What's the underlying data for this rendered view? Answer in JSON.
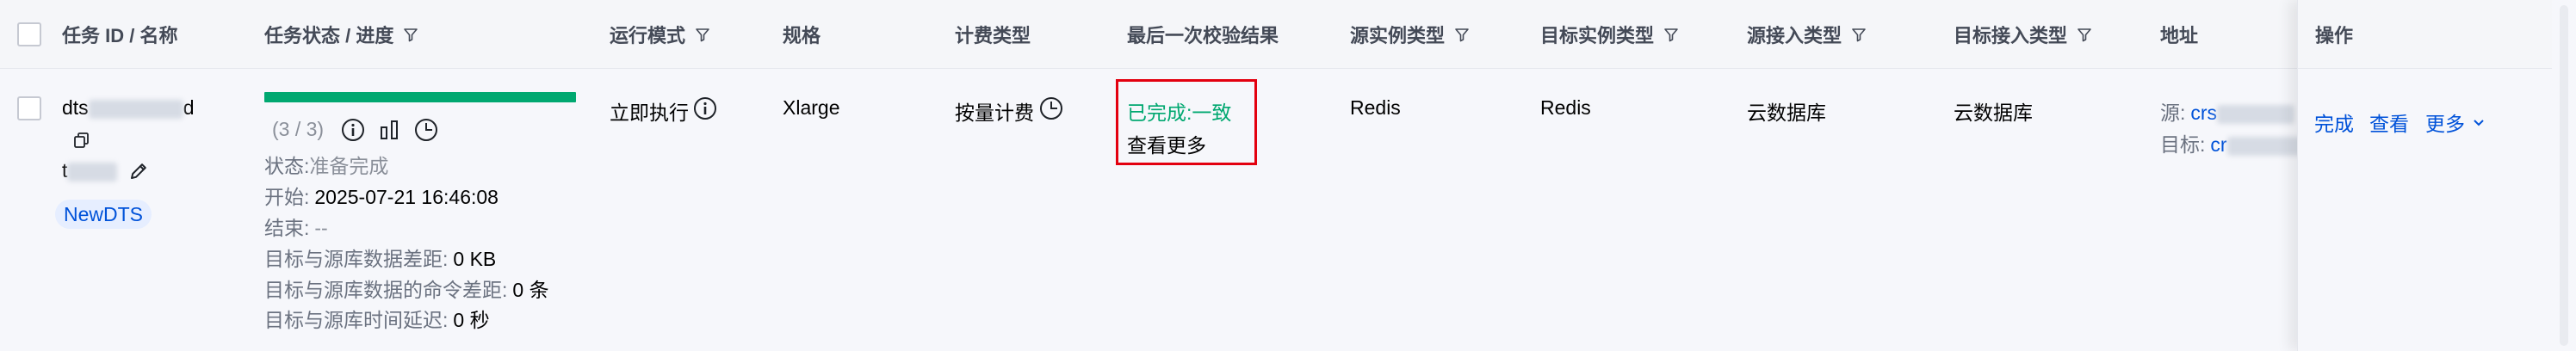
{
  "header": {
    "task_id_name": "任务 ID / 名称",
    "task_status_progress": "任务状态 / 进度",
    "run_mode": "运行模式",
    "spec": "规格",
    "billing_type": "计费类型",
    "last_check_result": "最后一次校验结果",
    "source_instance_type": "源实例类型",
    "target_instance_type": "目标实例类型",
    "source_access_type": "源接入类型",
    "target_access_type": "目标接入类型",
    "address": "地址",
    "operation": "操作"
  },
  "row": {
    "task_id_prefix": "dts",
    "task_id_suffix": "d",
    "task_name_prefix": "t",
    "tag": "NewDTS",
    "progress": {
      "fraction": 1.0,
      "text": "(3 / 3)"
    },
    "status_label": "状态:",
    "status_value": "准备完成",
    "start_label": "开始:",
    "start_value": "2025-07-21 16:46:08",
    "end_label": "结束:",
    "end_value": "--",
    "data_diff_label": "目标与源库数据差距:",
    "data_diff_value": "0 KB",
    "cmd_diff_label": "目标与源库数据的命令差距:",
    "cmd_diff_value": "0 条",
    "time_delay_label": "目标与源库时间延迟:",
    "time_delay_value": "0 秒",
    "run_mode": "立即执行",
    "spec": "Xlarge",
    "billing_type": "按量计费",
    "check_result": "已完成:一致",
    "check_more": "查看更多",
    "source_instance_type": "Redis",
    "target_instance_type": "Redis",
    "source_access_type": "云数据库",
    "target_access_type": "云数据库",
    "address_source_label": "源:",
    "address_source_prefix": "crs",
    "address_target_label": "目标:",
    "address_target_prefix": "cr"
  },
  "operations": {
    "complete": "完成",
    "view": "查看",
    "more": "更多"
  },
  "colors": {
    "link": "#0052d9",
    "success": "#00a870",
    "highlight_box": "#e3000f"
  },
  "icons": {
    "filter": "filter-icon",
    "copy": "copy-icon",
    "edit": "edit-icon",
    "info": "info-icon",
    "chart": "bar-chart-icon",
    "clock": "clock-icon",
    "chevron": "chevron-down-icon"
  }
}
